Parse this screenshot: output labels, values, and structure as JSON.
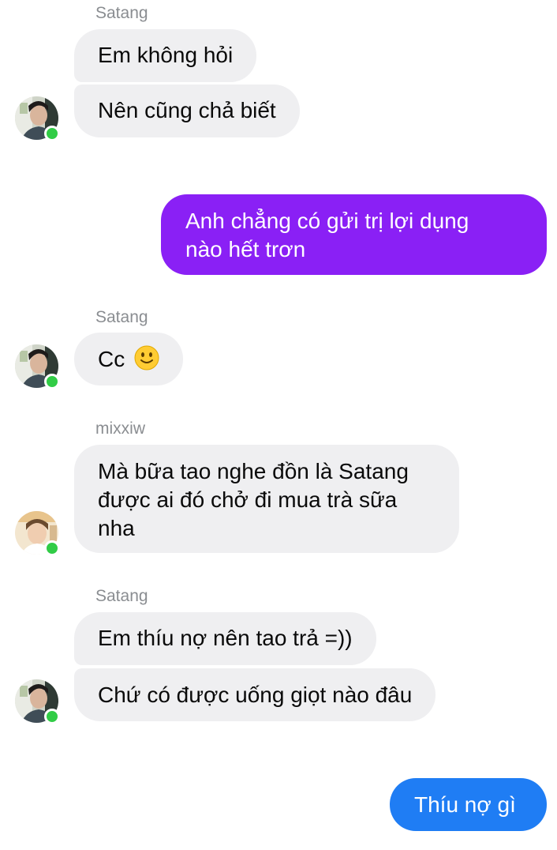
{
  "conversation": {
    "messages": [
      {
        "sender": "Satang",
        "text": "Em không hỏi"
      },
      {
        "text": "Nên cũng chả biết"
      },
      {
        "direction": "outgoing",
        "lines": [
          "Anh chẳng có gửi trị lợi dụng",
          "nào hết trơn"
        ]
      },
      {
        "sender": "Satang",
        "text": "Cc"
      },
      {
        "sender": "mixxiw",
        "lines": [
          "Mà bữa tao nghe đồn là Satang",
          "được ai đó chở đi mua trà sữa",
          "nha"
        ]
      },
      {
        "sender": "Satang",
        "text": "Em thíu nợ nên tao trả =))"
      },
      {
        "text": "Chứ có được uống giọt nào đâu"
      },
      {
        "direction": "outgoing",
        "text": "Thíu nợ gì"
      }
    ]
  },
  "icons": {
    "emoji": "slightly-smiling-face",
    "presence": "online-dot"
  },
  "colors": {
    "incoming_bubble": "#efeff1",
    "outgoing_bubble_purple": "#8a20f5",
    "outgoing_bubble_blue": "#1f7df4",
    "online_dot": "#31cc46",
    "sender_name": "#8a8d91"
  }
}
